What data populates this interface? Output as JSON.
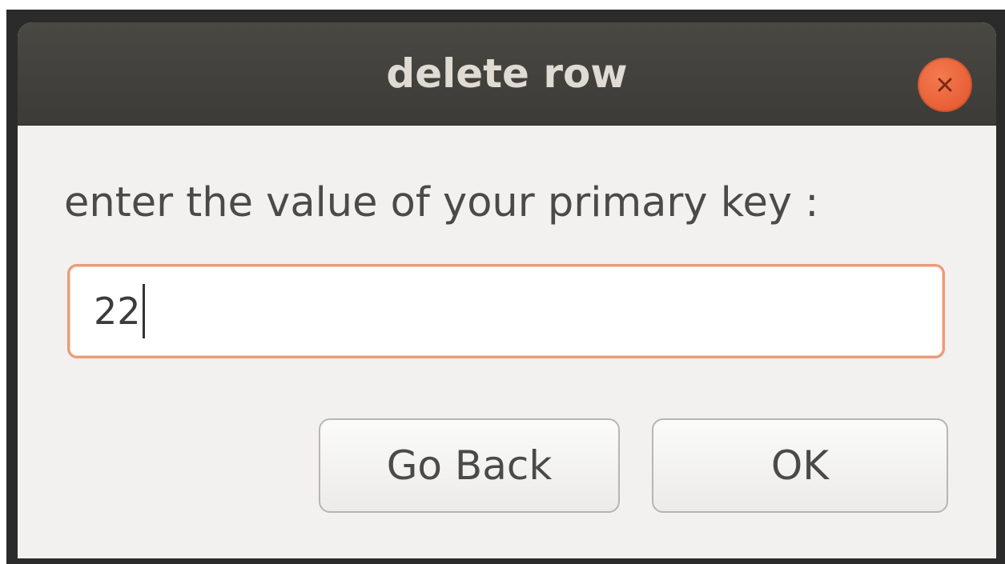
{
  "dialog": {
    "title": "delete row",
    "close_icon": "close-icon",
    "prompt": "enter the value of your primary key :",
    "input": {
      "value": "22",
      "placeholder": ""
    },
    "buttons": {
      "go_back": "Go Back",
      "ok": "OK"
    },
    "colors": {
      "titlebar": "#3c3b37",
      "close_button": "#e2532a",
      "focus_border": "#ec9a78",
      "background": "#f2f1f0"
    }
  }
}
